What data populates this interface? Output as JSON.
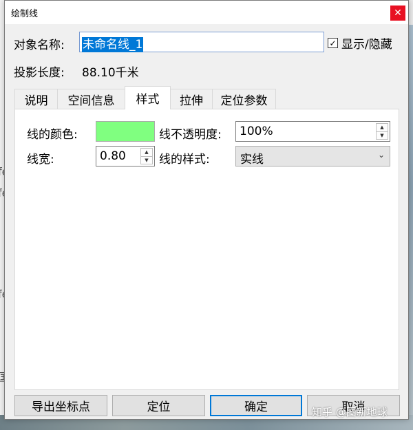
{
  "window": {
    "title": "绘制线",
    "close_glyph": "✕"
  },
  "object_name": {
    "label": "对象名称:",
    "value": "未命名线_1"
  },
  "visibility": {
    "checked": true,
    "check_glyph": "✓",
    "label": "显示/隐藏"
  },
  "projection": {
    "label": "投影长度:",
    "value": "88.10千米"
  },
  "tabs": [
    {
      "label": "说明",
      "active": false
    },
    {
      "label": "空间信息",
      "active": false
    },
    {
      "label": "样式",
      "active": true
    },
    {
      "label": "拉伸",
      "active": false
    },
    {
      "label": "定位参数",
      "active": false
    }
  ],
  "style_panel": {
    "line_color_label": "线的颜色:",
    "line_color": "#80ff80",
    "opacity_label": "线不透明度:",
    "opacity_value": "100%",
    "width_label": "线宽:",
    "width_value": "0.80",
    "style_label": "线的样式:",
    "style_value": "实线",
    "spin_up_glyph": "▲",
    "spin_down_glyph": "▼",
    "dropdown_glyph": "⌄"
  },
  "buttons": {
    "export": "导出坐标点",
    "locate": "定位",
    "ok": "确定",
    "cancel": "取消"
  },
  "watermark": "知乎 @图新地球",
  "background_fragments": [
    "fe",
    "fe",
    "fe",
    "国"
  ]
}
